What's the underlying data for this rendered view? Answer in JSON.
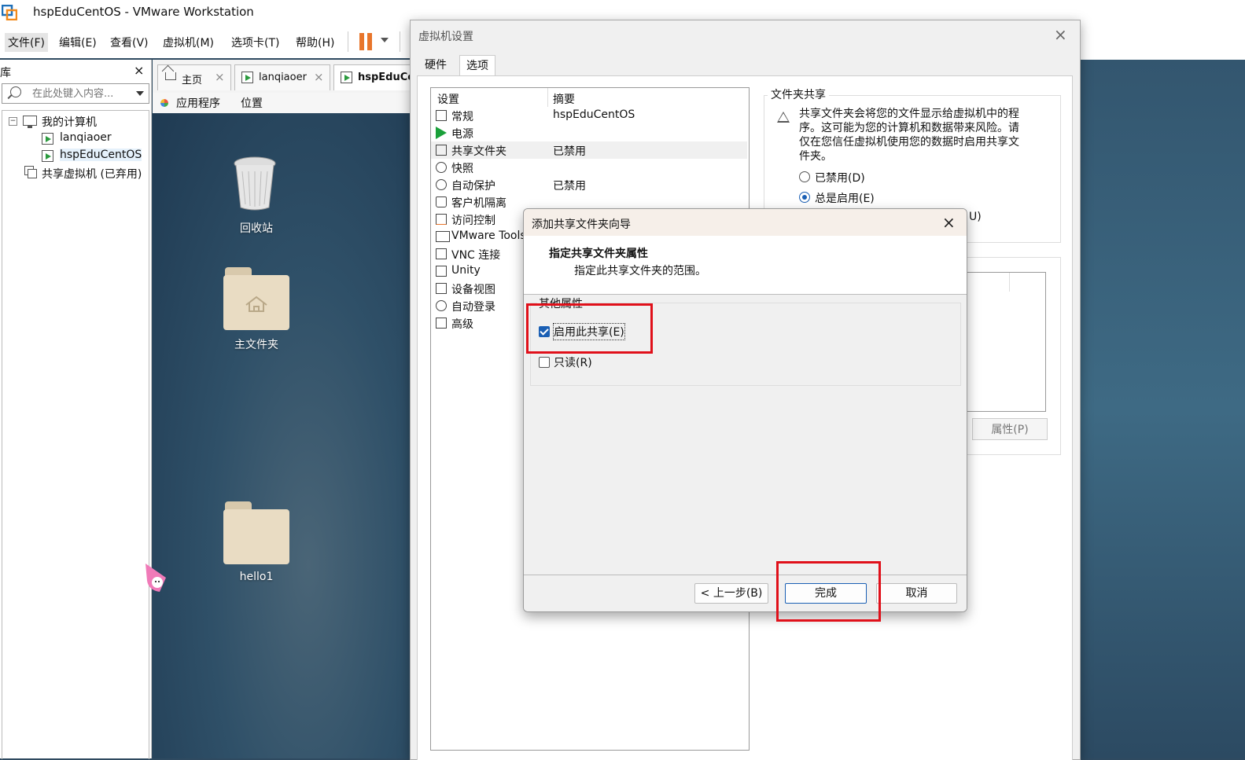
{
  "window": {
    "title": "hspEduCentOS - VMware Workstation",
    "app_icon": "vmware-logo-icon"
  },
  "menubar": {
    "items": [
      "文件(F)",
      "编辑(E)",
      "查看(V)",
      "虚拟机(M)",
      "选项卡(T)",
      "帮助(H)"
    ],
    "pause_color": "#e8752b"
  },
  "library": {
    "title": "库",
    "close": "×",
    "search_placeholder": "在此处键入内容...",
    "tree": {
      "my_computer": "我的计算机",
      "vm1": "lanqiaoer",
      "vm2": "hspEduCentOS",
      "shared": "共享虚拟机 (已弃用)"
    }
  },
  "tabs": [
    {
      "label": "主页",
      "icon": "home-icon"
    },
    {
      "label": "lanqiaoer",
      "icon": "vm-icon"
    },
    {
      "label": "hspEduCer",
      "icon": "vm-icon"
    }
  ],
  "guest": {
    "topbar": {
      "apps": "应用程序",
      "places": "位置"
    },
    "desktop_icons": {
      "trash": "回收站",
      "home": "主文件夹",
      "folder": "hello1"
    }
  },
  "settings_dialog": {
    "title": "虚拟机设置",
    "tabs": [
      "硬件",
      "选项"
    ],
    "active_tab": "选项",
    "list_headers": {
      "setting": "设置",
      "summary": "摘要"
    },
    "rows": [
      {
        "name": "常规",
        "summary": "hspEduCentOS",
        "icon": "monitor-icon"
      },
      {
        "name": "电源",
        "summary": "",
        "icon": "power-play-icon"
      },
      {
        "name": "共享文件夹",
        "summary": "已禁用",
        "icon": "shared-folder-icon"
      },
      {
        "name": "快照",
        "summary": "",
        "icon": "snapshot-icon"
      },
      {
        "name": "自动保护",
        "summary": "已禁用",
        "icon": "clock-icon"
      },
      {
        "name": "客户机隔离",
        "summary": "",
        "icon": "lock-icon"
      },
      {
        "name": "访问控制",
        "summary": "",
        "icon": "access-control-icon"
      },
      {
        "name": "VMware Tools",
        "summary": "",
        "icon": "vm-tools-icon"
      },
      {
        "name": "VNC 连接",
        "summary": "",
        "icon": "vnc-icon"
      },
      {
        "name": "Unity",
        "summary": "",
        "icon": "unity-icon"
      },
      {
        "name": "设备视图",
        "summary": "",
        "icon": "device-view-icon"
      },
      {
        "name": "自动登录",
        "summary": "",
        "icon": "autologin-icon"
      },
      {
        "name": "高级",
        "summary": "",
        "icon": "advanced-icon"
      }
    ],
    "folder_sharing": {
      "title": "文件夹共享",
      "warning": "共享文件夹会将您的文件显示给虚拟机中的程序。这可能为您的计算机和数据带来风险。请仅在您信任虚拟机使用您的数据时启用共享文件夹。",
      "options": [
        "已禁用(D)",
        "总是启用(E)"
      ],
      "partial_option": "U)",
      "selected": "总是启用(E)"
    },
    "properties_button": "属性(P)"
  },
  "wizard": {
    "title": "添加共享文件夹向导",
    "heading": "指定共享文件夹属性",
    "subheading": "指定此共享文件夹的范围。",
    "group_title": "其他属性",
    "enable_share": {
      "label": "启用此共享(E)",
      "checked": true
    },
    "read_only": {
      "label": "只读(R)",
      "checked": false
    },
    "buttons": {
      "back": "< 上一步(B)",
      "finish": "完成",
      "cancel": "取消"
    }
  },
  "annotation_color": "#e0101a"
}
